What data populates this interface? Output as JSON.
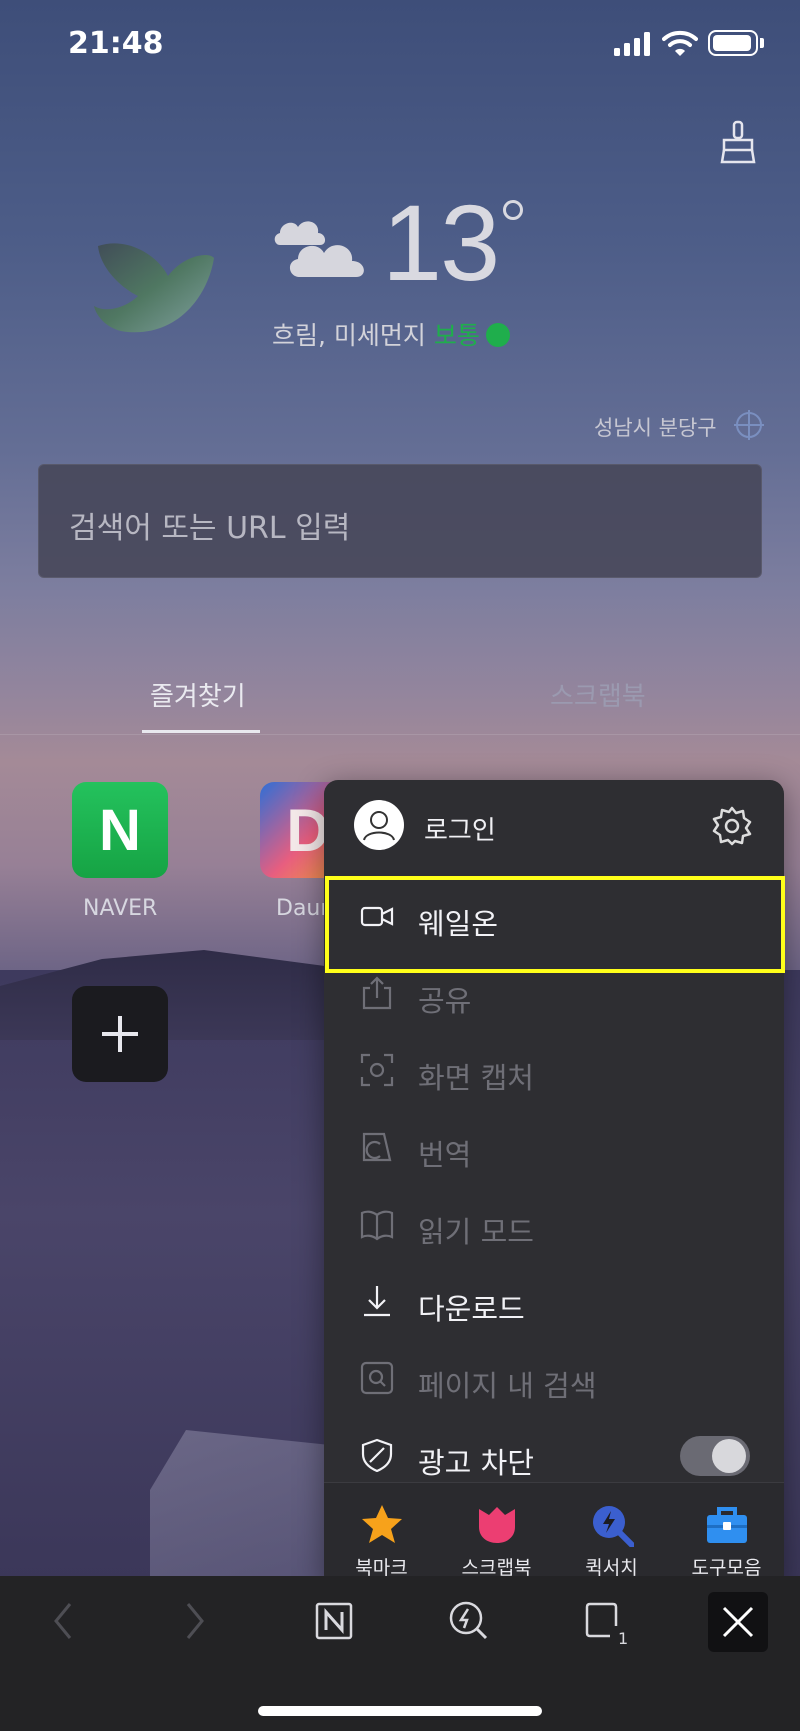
{
  "status": {
    "time": "21:48"
  },
  "weather": {
    "temperature": "13",
    "description": "흐림, 미세먼지",
    "dust_level": "보통",
    "location": "성남시 분당구"
  },
  "search": {
    "placeholder": "검색어 또는 URL 입력"
  },
  "tabs": [
    {
      "label": "즐겨찾기",
      "active": true
    },
    {
      "label": "스크랩북",
      "active": false
    }
  ],
  "quick_links": [
    {
      "label": "NAVER",
      "letter": "N"
    },
    {
      "label": "Daum",
      "letter": "D"
    }
  ],
  "menu": {
    "login_label": "로그인",
    "items": [
      {
        "label": "웨일온",
        "icon": "video-camera-icon",
        "highlighted": true
      },
      {
        "label": "공유",
        "icon": "share-icon"
      },
      {
        "label": "화면 캡처",
        "icon": "screen-capture-icon"
      },
      {
        "label": "번역",
        "icon": "translate-icon"
      },
      {
        "label": "읽기 모드",
        "icon": "book-icon"
      },
      {
        "label": "다운로드",
        "icon": "download-icon"
      },
      {
        "label": "페이지 내 검색",
        "icon": "find-in-page-icon"
      },
      {
        "label": "광고 차단",
        "icon": "shield-icon",
        "toggle": true
      }
    ],
    "bottom": [
      {
        "label": "북마크",
        "icon": "star-icon",
        "color": "#f7a21b"
      },
      {
        "label": "스크랩북",
        "icon": "tulip-icon",
        "color": "#ec3e72"
      },
      {
        "label": "퀵서치",
        "icon": "quick-search-icon",
        "color": "#3b5fcf"
      },
      {
        "label": "도구모음",
        "icon": "toolbox-icon",
        "color": "#2f8ff0"
      }
    ]
  },
  "toolbar": {
    "tab_count": "1"
  },
  "colors": {
    "highlight": "#ffff1a",
    "dust_good": "#1fae4c",
    "menu_bg": "#2e2e32"
  }
}
